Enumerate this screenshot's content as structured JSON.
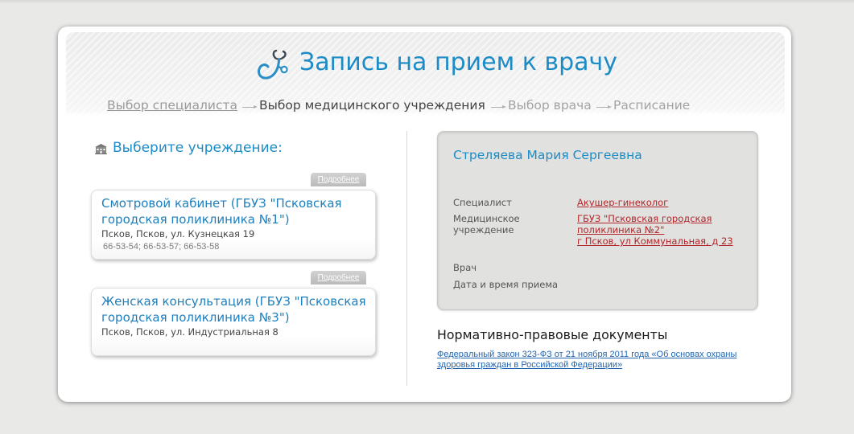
{
  "header": {
    "title": "Запись на прием к врачу"
  },
  "icons": {
    "title": "stethoscope-icon",
    "heading": "building-icon",
    "step_separator": "arrow-right-icon"
  },
  "colors": {
    "accent": "#1c8bc6",
    "link": "#2366b1",
    "value": "#b2262b"
  },
  "steps": [
    "Выбор специалиста",
    "Выбор медицинского учреждения",
    "Выбор врача",
    "Расписание"
  ],
  "institutions": {
    "heading": "Выберите учреждение:",
    "items": [
      {
        "more_label": "Подробнее",
        "name": "Смотровой кабинет (ГБУЗ \"Псковская городская поликлиника №1\")",
        "address": "Псков, Псков, ул. Кузнецкая 19",
        "phones": "66-53-54; 66-53-57; 66-53-58"
      },
      {
        "more_label": "Подробнее",
        "name": "Женская консультация (ГБУЗ \"Псковская городская поликлиника №3\")",
        "address": "Псков, Псков, ул. Индустриальная 8"
      }
    ]
  },
  "summary": {
    "patient_name": "Стреляева Мария Сергеевна",
    "specialist": {
      "label": "Специалист",
      "value": "Акушер-гинеколог"
    },
    "institution": {
      "label": "Медицинское учреждение",
      "name": "ГБУЗ \"Псковская городская поликлиника №2\"",
      "address": "г Псков, ул Коммунальная, д 23"
    },
    "doctor": {
      "label": "Врач"
    },
    "appointment_time": {
      "label": "Дата и время приема"
    }
  },
  "documents": {
    "heading": "Нормативно-правовые документы",
    "links": [
      "Федеральный закон 323-ФЗ от 21 ноября 2011 года «Об основах охраны здоровья граждан в Российской Федерации»"
    ]
  }
}
